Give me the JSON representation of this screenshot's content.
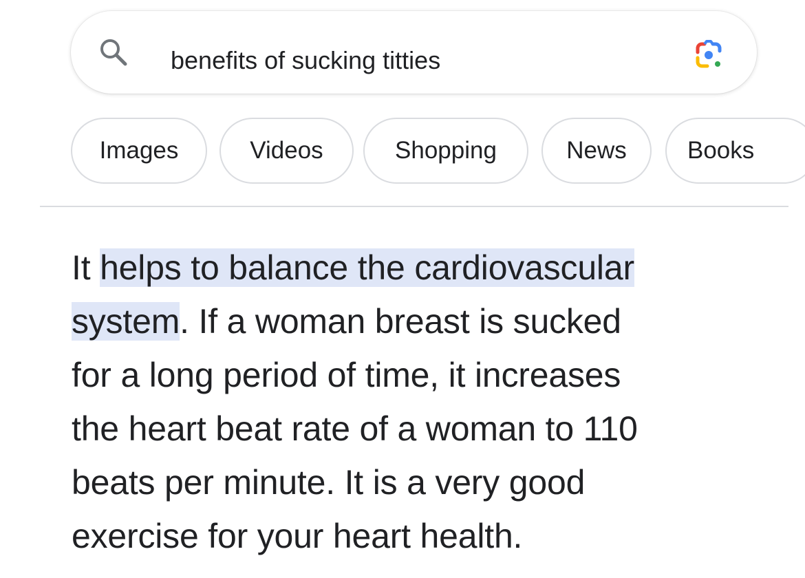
{
  "search": {
    "query": "benefits of sucking titties",
    "left_icon": "search-icon",
    "right_icon": "google-lens-icon"
  },
  "chips": [
    {
      "label": "Images"
    },
    {
      "label": "Videos"
    },
    {
      "label": "Shopping"
    },
    {
      "label": "News"
    },
    {
      "label": "Books"
    }
  ],
  "answer": {
    "lines": [
      {
        "prefix": "It ",
        "highlight": "helps to balance the cardiovascular",
        "suffix": ""
      },
      {
        "prefix": "",
        "highlight": "system",
        "suffix": ". If a woman breast is sucked"
      },
      {
        "prefix": "for a long period of time, it increases",
        "highlight": "",
        "suffix": ""
      },
      {
        "prefix": "the heart beat rate of a woman to 110",
        "highlight": "",
        "suffix": ""
      },
      {
        "prefix": "beats per minute. It is a very good",
        "highlight": "",
        "suffix": ""
      },
      {
        "prefix": "exercise for your heart health.",
        "highlight": "",
        "suffix": ""
      }
    ]
  },
  "colors": {
    "text": "#202124",
    "chip_border": "#dadce0",
    "highlight": "#dfe6f7",
    "lens_blue": "#4285f4",
    "lens_red": "#ea4335",
    "lens_yellow": "#fbbc05",
    "lens_green": "#34a853"
  }
}
